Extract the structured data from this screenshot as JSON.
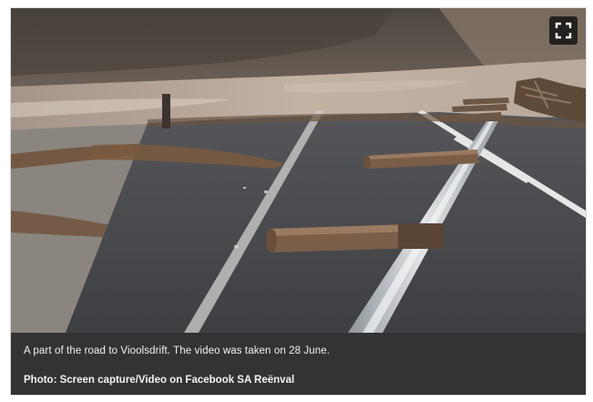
{
  "figure": {
    "caption": "A part of the road to Vioolsdrift. The video was taken on 28 June.",
    "credit": "Photo: Screen capture/Video on Facebook SA Reënval"
  },
  "controls": {
    "fullscreen_icon": "fullscreen-icon"
  },
  "colors": {
    "caption_background": "#333333",
    "caption_text": "#f2f2f2",
    "floodwater": "#b7a89a",
    "asphalt": "#4a4b4d",
    "mountain": "#5a4f45"
  }
}
